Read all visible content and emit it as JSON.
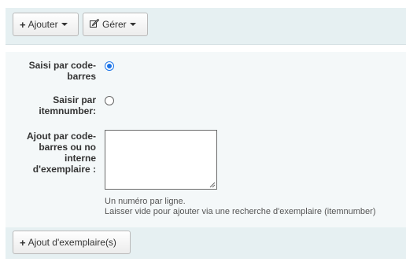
{
  "toolbar": {
    "add_label": "Ajouter",
    "manage_label": "Gérer"
  },
  "form": {
    "barcode_label_line1": "Saisi par code-",
    "barcode_label_line2": "barres",
    "barcode_selected": true,
    "itemnumber_label_line1": "Saisir par",
    "itemnumber_label_line2": "itemnumber:",
    "itemnumber_selected": false,
    "list_label_line1": "Ajout par code-",
    "list_label_line2": "barres ou no",
    "list_label_line3": "interne",
    "list_label_line4": "d'exemplaire :",
    "list_value": "",
    "hint_line1": "Un numéro par ligne.",
    "hint_line2": "Laisser vide pour ajouter via une recherche d'exemplaire (itemnumber)"
  },
  "footer": {
    "add_items_label": "Ajout d'exemplaire(s)"
  },
  "icons": {
    "add": "plus-icon",
    "manage": "edit-icon",
    "dropdown": "caret-down-icon"
  },
  "colors": {
    "toolbar_bg": "#e6f0f2",
    "form_bg": "#f4f8f9",
    "radio_accent": "#1a73e8"
  }
}
